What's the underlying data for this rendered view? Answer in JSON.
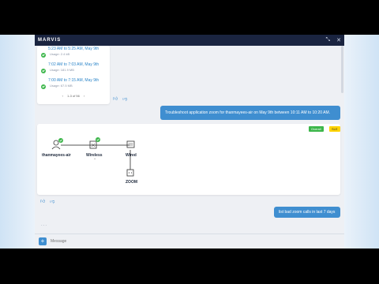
{
  "app": {
    "brand": "MARVIS",
    "colors": {
      "accent": "#3f8ed0",
      "topbar": "#1a2440",
      "success": "#3cb64a",
      "warning": "#ffd400"
    }
  },
  "history": {
    "rows": [
      {
        "title": "5:23 AM to 5:25 AM, May 9th",
        "sub": "Usage: 2.4 kB"
      },
      {
        "title": "7:02 AM to 7:03 AM, May 9th",
        "sub": "Usage: 181.9 MB"
      },
      {
        "title": "7:00 AM to 7:15 AM, May 9th",
        "sub": "Usage: 67.5 MB"
      }
    ],
    "pager": "1-3 of 56"
  },
  "messages": {
    "user_query": "Troubleshoot application zoom for thanmayees-air on May 9th between 10:11 AM to 10:20 AM.",
    "user_followup": "list bad zoom calls in last 7 days"
  },
  "topology": {
    "badge_ok": "Overall",
    "badge_warn": "SLE",
    "nodes": {
      "client": "thanmayees-air",
      "wireless": "Wireless",
      "wired": "Wired",
      "app": "ZOOM"
    }
  },
  "composer": {
    "placeholder": "Message",
    "typing": "..."
  },
  "icons": [
    "logo",
    "minimize-icon",
    "close-icon",
    "thumbs-up-icon",
    "thumbs-down-icon",
    "laptop-icon",
    "access-point-icon",
    "switch-icon",
    "app-icon",
    "plus-icon",
    "check-icon"
  ]
}
